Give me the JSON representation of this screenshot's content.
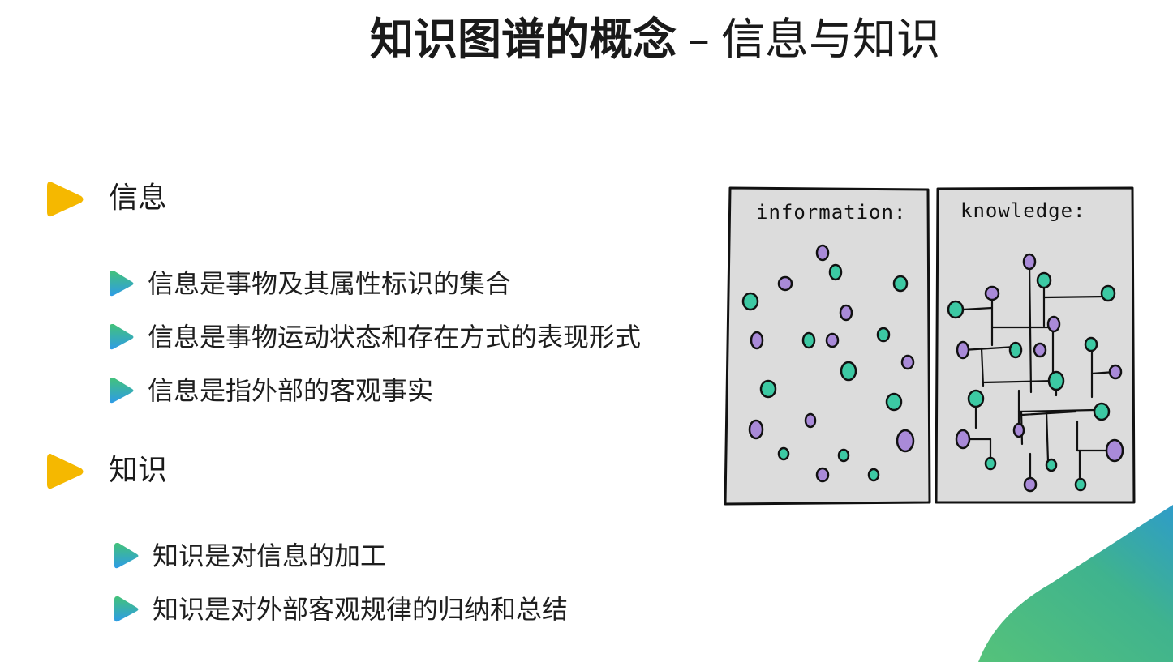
{
  "slide": {
    "title_bold": "知识图谱的概念",
    "title_dash": "–",
    "title_rest": "信息与知识"
  },
  "sections": [
    {
      "heading": "信息",
      "bullets": [
        "信息是事物及其属性标识的集合",
        "信息是事物运动状态和存在方式的表现形式",
        "信息是指外部的客观事实"
      ]
    },
    {
      "heading": "知识",
      "bullets": [
        "知识是对信息的加工",
        "知识是对外部客观规律的归纳和总结"
      ]
    }
  ],
  "illustration": {
    "left_label": "information:",
    "right_label": "knowledge:"
  },
  "colors": {
    "heading_marker": "#F5B800",
    "bullet_gradient_top": "#43C27A",
    "bullet_gradient_bottom": "#2E9CE6",
    "dot_purple": "#A98AD8",
    "dot_green": "#3CC9A3",
    "panel_fill": "#DCDCDC"
  }
}
